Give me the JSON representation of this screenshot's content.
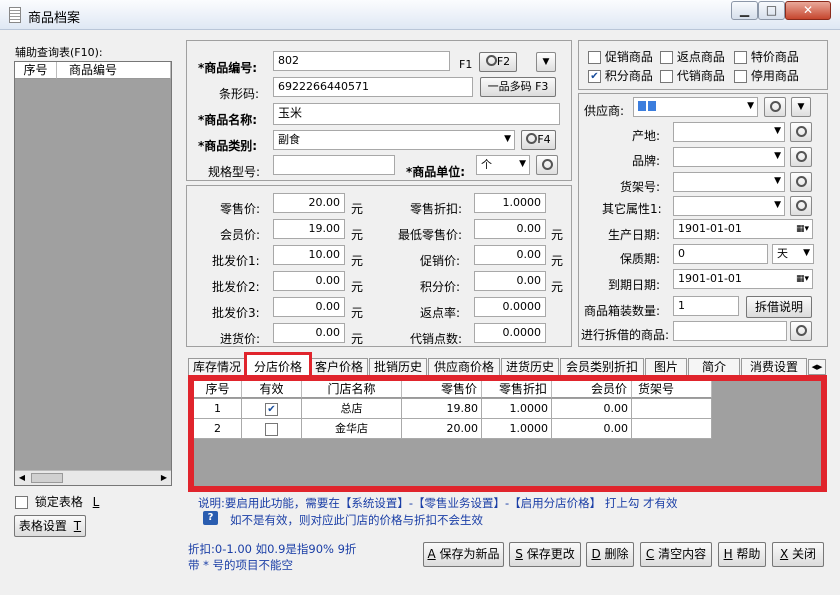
{
  "window": {
    "title": "商品档案",
    "min": "▁",
    "max": "□",
    "close": "✕"
  },
  "left_panel": {
    "title": "辅助查询表(F10):",
    "columns": [
      "序号",
      "商品编号"
    ],
    "lock_label": "锁定表格",
    "lock_key": "L",
    "settings_label": "表格设置",
    "settings_key": "T"
  },
  "basic": {
    "code_label": "*商品编号:",
    "code_value": "802",
    "code_key": "F1",
    "code_btn": "F2",
    "barcode_label": "条形码:",
    "barcode_value": "6922266440571",
    "multi_code_btn": "一品多码 F3",
    "name_label": "*商品名称:",
    "name_value": "玉米",
    "category_label": "*商品类别:",
    "category_value": "副食",
    "category_btn": "F4",
    "spec_label": "规格型号:",
    "spec_value": "",
    "unit_label": "*商品单位:",
    "unit_value": "个"
  },
  "flags": [
    {
      "label": "促销商品",
      "checked": false
    },
    {
      "label": "返点商品",
      "checked": false
    },
    {
      "label": "特价商品",
      "checked": false
    },
    {
      "label": "积分商品",
      "checked": true
    },
    {
      "label": "代销商品",
      "checked": false
    },
    {
      "label": "停用商品",
      "checked": false
    }
  ],
  "prices": {
    "retail_label": "零售价:",
    "retail_value": "20.00",
    "member_label": "会员价:",
    "member_value": "19.00",
    "wholesale1_label": "批发价1:",
    "wholesale1_value": "10.00",
    "wholesale2_label": "批发价2:",
    "wholesale2_value": "0.00",
    "wholesale3_label": "批发价3:",
    "wholesale3_value": "0.00",
    "purchase_label": "进货价:",
    "purchase_value": "0.00",
    "unit": "元",
    "discount_label": "零售折扣:",
    "discount_value": "1.0000",
    "min_retail_label": "最低零售价:",
    "min_retail_value": "0.00",
    "promo_label": "促销价:",
    "promo_value": "0.00",
    "points_label": "积分价:",
    "points_value": "0.00",
    "rebate_label": "返点率:",
    "rebate_value": "0.0000",
    "consign_label": "代销点数:",
    "consign_value": "0.0000"
  },
  "supplier": {
    "supplier_label": "供应商:",
    "origin_label": "产地:",
    "brand_label": "品牌:",
    "shelf_label": "货架号:",
    "other_label": "其它属性1:",
    "prod_date_label": "生产日期:",
    "prod_date_value": "1901-01-01",
    "shelf_life_label": "保质期:",
    "shelf_life_value": "0",
    "shelf_life_unit": "天",
    "expiry_label": "到期日期:",
    "expiry_value": "1901-01-01",
    "box_qty_label": "商品箱装数量:",
    "box_qty_value": "1",
    "split_btn": "拆借说明",
    "split_goods_label": "进行拆借的商品:"
  },
  "tabs": [
    "库存情况",
    "分店价格",
    "客户价格",
    "批销历史",
    "供应商价格",
    "进货历史",
    "会员类别折扣",
    "图片",
    "简介",
    "消费设置"
  ],
  "store_grid": {
    "columns": [
      "序号",
      "有效",
      "门店名称",
      "零售价",
      "零售折扣",
      "会员价",
      "货架号"
    ],
    "rows": [
      {
        "no": "1",
        "valid": true,
        "store": "总店",
        "retail": "19.80",
        "discount": "1.0000",
        "member": "0.00",
        "shelf": ""
      },
      {
        "no": "2",
        "valid": false,
        "store": "金华店",
        "retail": "20.00",
        "discount": "1.0000",
        "member": "0.00",
        "shelf": ""
      }
    ]
  },
  "notes": {
    "line1": "说明:要启用此功能，需要在【系统设置】-【零售业务设置】-【启用分店价格】  打上勾 才有效",
    "line2": "如不是有效，则对应此门店的价格与折扣不会生效",
    "bottom1": "折扣:0-1.00 如0.9是指90%  9折",
    "bottom2": "带 * 号的项目不能空"
  },
  "actions": [
    {
      "key": "A",
      "label": "保存为新品"
    },
    {
      "key": "S",
      "label": "保存更改"
    },
    {
      "key": "D",
      "label": "删除"
    },
    {
      "key": "C",
      "label": "清空内容"
    },
    {
      "key": "H",
      "label": "帮助"
    },
    {
      "key": "X",
      "label": "关闭"
    }
  ],
  "colors": {
    "highlight": "#e0242c",
    "note_text": "#1a3ea6"
  }
}
